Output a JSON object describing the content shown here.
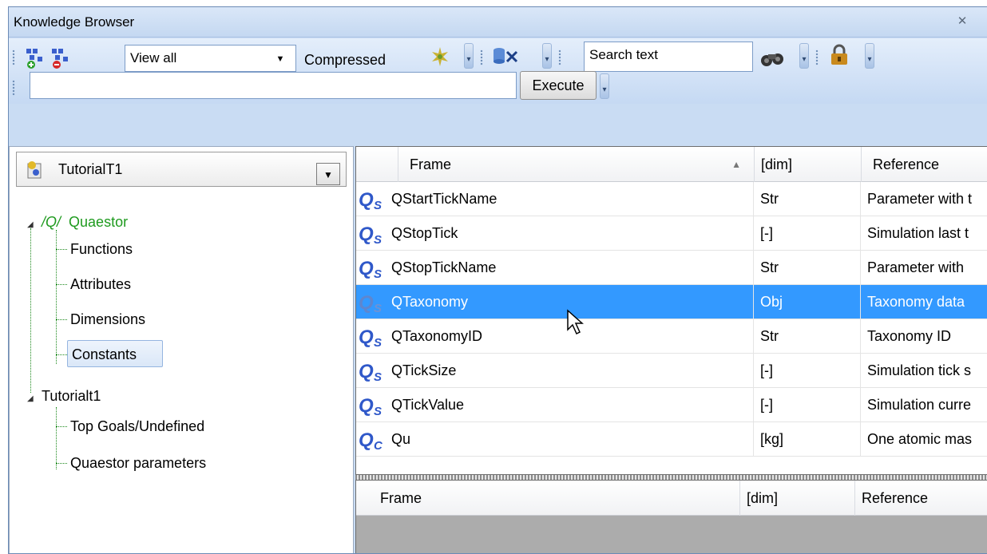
{
  "window": {
    "title": "Knowledge Browser"
  },
  "toolbar": {
    "view_selected": "View all",
    "compressed_label": "Compressed",
    "search_value": "Search text",
    "command_value": "",
    "execute_label": "Execute",
    "icons": [
      "add-frame-icon",
      "remove-frame-icon",
      "compress-icon",
      "db-export-icon",
      "binoculars-icon",
      "lock-icon"
    ]
  },
  "project": {
    "name": "TutorialT1"
  },
  "tree": {
    "quaestor": {
      "prefix": "/Q/",
      "label": "Quaestor"
    },
    "children": [
      "Functions",
      "Attributes",
      "Dimensions",
      "Constants"
    ],
    "tutorial": {
      "label": "Tutorialt1"
    },
    "tutorial_children": [
      "Top Goals/Undefined",
      "Quaestor parameters"
    ],
    "selected": "Constants"
  },
  "grid": {
    "columns": [
      "Frame",
      "[dim]",
      "Reference"
    ],
    "sort_indicator": "▲",
    "rows": [
      {
        "icon": "qs-icon",
        "frame": "QStartTickName",
        "dim": "Str",
        "reference": "Parameter with t"
      },
      {
        "icon": "qs-icon",
        "frame": "QStopTick",
        "dim": "[-]",
        "reference": "Simulation last t"
      },
      {
        "icon": "qs-icon",
        "frame": "QStopTickName",
        "dim": "Str",
        "reference": "Parameter with"
      },
      {
        "icon": "qs-icon",
        "frame": "QTaxonomy",
        "dim": "Obj",
        "reference": "Taxonomy data",
        "selected": true
      },
      {
        "icon": "qs-icon",
        "frame": "QTaxonomyID",
        "dim": "Str",
        "reference": "Taxonomy ID"
      },
      {
        "icon": "qs-icon",
        "frame": "QTickSize",
        "dim": "[-]",
        "reference": "Simulation tick s"
      },
      {
        "icon": "qs-icon",
        "frame": "QTickValue",
        "dim": "[-]",
        "reference": "Simulation curre"
      },
      {
        "icon": "qc-icon",
        "frame": "Qu",
        "dim": "[kg]",
        "reference": "One atomic mas"
      }
    ]
  },
  "grid2": {
    "columns": [
      "Frame",
      "[dim]",
      "Reference"
    ]
  },
  "colors": {
    "selection": "#3399ff",
    "tree_green": "#1e9a1e",
    "toolbar": "#c9dcf3"
  }
}
